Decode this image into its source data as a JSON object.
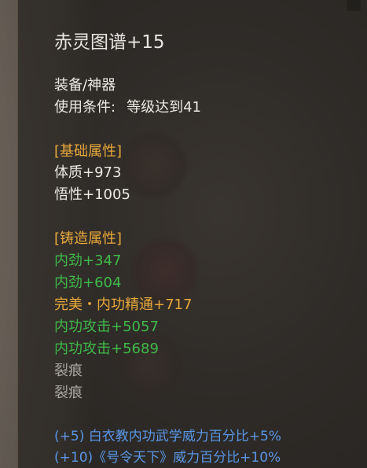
{
  "item": {
    "name": "赤灵图谱+15",
    "category": "装备/神器",
    "requirement_label": "使用条件:",
    "requirement_value": "等级达到41"
  },
  "base_attributes": {
    "header": "[基础属性]",
    "stats": [
      "体质+973",
      "悟性+1005"
    ]
  },
  "forge_attributes": {
    "header": "[铸造属性]",
    "stats": [
      {
        "text": "内劲+347",
        "color": "green"
      },
      {
        "text": "内劲+604",
        "color": "green"
      },
      {
        "text": "完美・内功精通+717",
        "color": "orange"
      },
      {
        "text": "内功攻击+5057",
        "color": "green"
      },
      {
        "text": "内功攻击+5689",
        "color": "green"
      },
      {
        "text": "裂痕",
        "color": "gray"
      },
      {
        "text": "裂痕",
        "color": "gray"
      }
    ]
  },
  "set_bonuses": [
    "(+5) 白衣教内功武学威力百分比+5%",
    "(+10)《号令天下》威力百分比+10%"
  ],
  "colors": {
    "title": "#e8e6e2",
    "section_header": "#e8a83a",
    "green_stat": "#3fb94a",
    "orange_stat": "#e8a83a",
    "gray_stat": "#a9a6a2",
    "bonus_blue": "#5a96e6"
  }
}
